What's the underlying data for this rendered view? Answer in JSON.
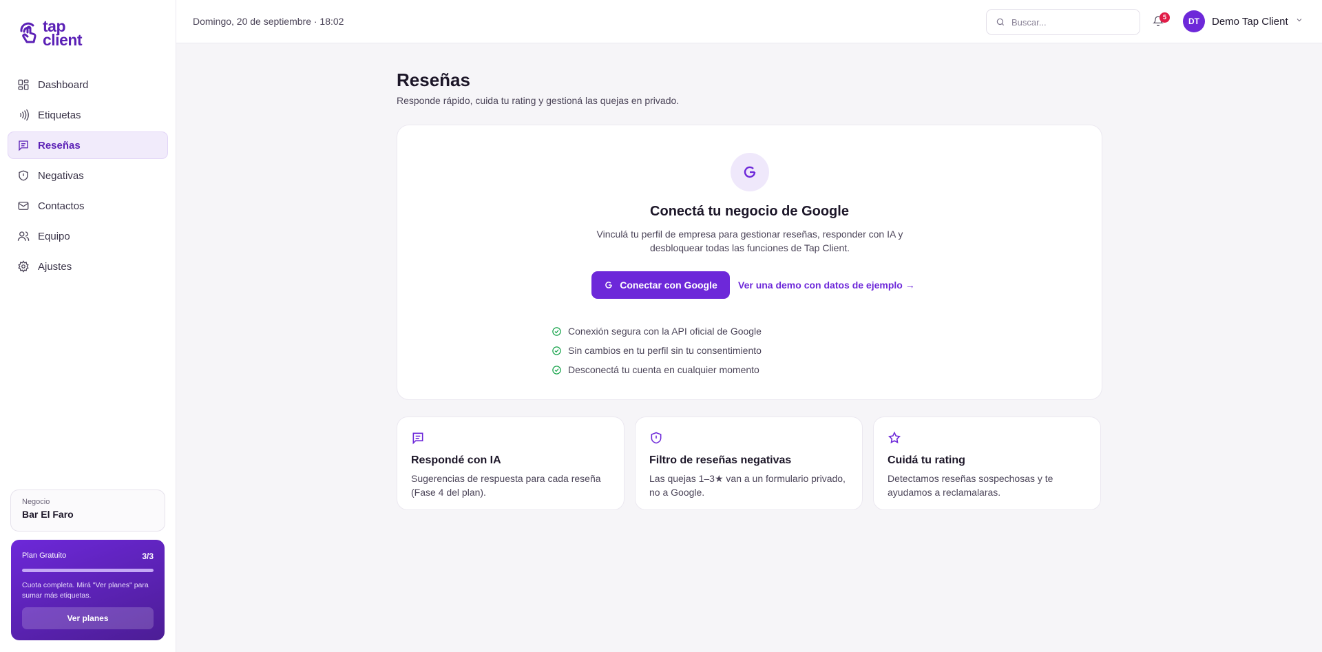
{
  "brand": {
    "line1": "tap",
    "line2": "client",
    "color": "#5b21b6"
  },
  "sidebar": {
    "items": [
      {
        "label": "Dashboard",
        "icon": "dashboard-icon"
      },
      {
        "label": "Etiquetas",
        "icon": "nfc-icon"
      },
      {
        "label": "Reseñas",
        "icon": "reviews-icon",
        "active": true
      },
      {
        "label": "Negativas",
        "icon": "shield-icon"
      },
      {
        "label": "Contactos",
        "icon": "mail-icon"
      },
      {
        "label": "Equipo",
        "icon": "team-icon"
      },
      {
        "label": "Ajustes",
        "icon": "gear-icon"
      }
    ],
    "business": {
      "label": "Negocio",
      "name": "Bar El Faro"
    },
    "plan": {
      "name": "Plan Gratuito",
      "count": "3/3",
      "progress": 1.0,
      "note": "Cuota completa. Mirá \"Ver planes\" para sumar más etiquetas.",
      "button": "Ver planes"
    }
  },
  "topbar": {
    "date": "Domingo, 20 de septiembre · 18:02",
    "search_placeholder": "Buscar...",
    "notifications": "5",
    "user_initials": "DT",
    "user_name": "Demo Tap Client"
  },
  "page": {
    "title": "Reseñas",
    "subtitle": "Responde rápido, cuida tu rating y gestioná las quejas en privado."
  },
  "connect": {
    "icon": "google-g-icon",
    "title": "Conectá tu negocio de Google",
    "description": "Vinculá tu perfil de empresa para gestionar reseñas, responder con IA y desbloquear todas las funciones de Tap Client.",
    "button": "Conectar con Google",
    "demo_link": "Ver una demo con datos de ejemplo →",
    "checks": [
      "Conexión segura con la API oficial de Google",
      "Sin cambios en tu perfil sin tu consentimiento",
      "Desconectá tu cuenta en cualquier momento"
    ]
  },
  "features": [
    {
      "icon": "message-icon",
      "title": "Respondé con IA",
      "desc": "Sugerencias de respuesta para cada reseña (Fase 4 del plan)."
    },
    {
      "icon": "shield-alert-icon",
      "title": "Filtro de reseñas negativas",
      "desc": "Las quejas 1–3★ van a un formulario privado, no a Google."
    },
    {
      "icon": "star-icon",
      "title": "Cuidá tu rating",
      "desc": "Detectamos reseñas sospechosas y te ayudamos a reclamalaras."
    }
  ],
  "colors": {
    "accent": "#6d28d9",
    "success": "#16a34a",
    "badge": "#e11d48"
  }
}
